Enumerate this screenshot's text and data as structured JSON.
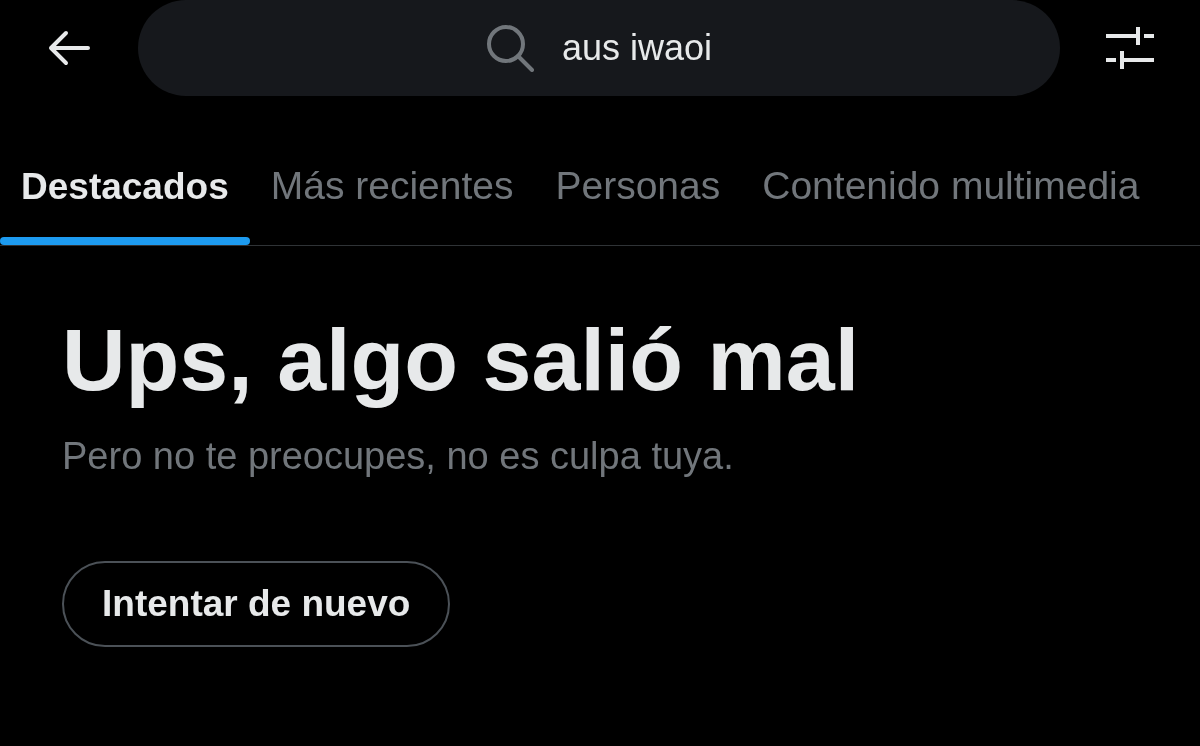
{
  "top_bar": {
    "search": {
      "value": "aus iwaoi"
    }
  },
  "tabs": [
    {
      "label": "Destacados",
      "selected": true
    },
    {
      "label": "Más recientes",
      "selected": false
    },
    {
      "label": "Personas",
      "selected": false
    },
    {
      "label": "Contenido multimedia",
      "selected": false
    }
  ],
  "error": {
    "title": "Ups, algo salió mal",
    "message": "Pero no te preocupes, no es culpa tuya.",
    "button": "Intentar de nuevo"
  }
}
